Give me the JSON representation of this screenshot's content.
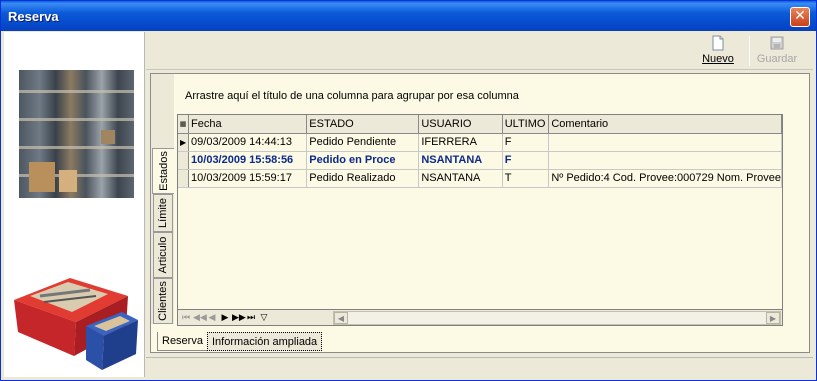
{
  "window": {
    "title": "Reserva",
    "close_icon": "close-icon"
  },
  "toolbar": {
    "new_label": "Nuevo",
    "save_label": "Guardar"
  },
  "vertical_tabs": [
    "Estados",
    "Límite",
    "Articulo",
    "Clientes"
  ],
  "group_hint": "Arrastre aquí el título de una columna para agrupar por esa columna",
  "grid": {
    "columns": [
      "Fecha",
      "ESTADO",
      "USUARIO",
      "ULTIMO",
      "Comentario"
    ],
    "rows": [
      {
        "fecha": "09/03/2009 14:44:13",
        "estado": "Pedido Pendiente",
        "usuario": "IFERRERA",
        "ultimo": "F",
        "comentario": ""
      },
      {
        "fecha": "10/03/2009 15:58:56",
        "estado": "Pedido en Proce",
        "usuario": "NSANTANA",
        "ultimo": "F",
        "comentario": ""
      },
      {
        "fecha": "10/03/2009 15:59:17",
        "estado": "Pedido Realizado",
        "usuario": "NSANTANA",
        "ultimo": "T",
        "comentario": "Nº Pedido:4 Cod. Provee:000729 Nom. Provee"
      }
    ]
  },
  "bottom_tabs": [
    "Reserva",
    "Información ampliada"
  ],
  "colors": {
    "title_bar": "#0b5ad8",
    "grid_background": "#fcf9e4",
    "bold_row_text": "#0b2a8c",
    "close_button": "#c9401b"
  }
}
